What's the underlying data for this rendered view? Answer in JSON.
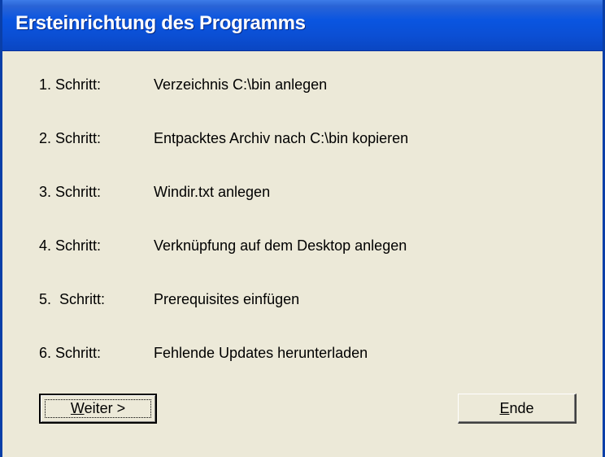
{
  "window": {
    "title": "Ersteinrichtung des Programms"
  },
  "steps": [
    {
      "number": "1. Schritt:",
      "description": "Verzeichnis C:\\bin anlegen"
    },
    {
      "number": "2. Schritt:",
      "description": "Entpacktes Archiv nach C:\\bin kopieren"
    },
    {
      "number": "3. Schritt:",
      "description": "Windir.txt anlegen"
    },
    {
      "number": "4. Schritt:",
      "description": "Verknüpfung auf dem Desktop anlegen"
    },
    {
      "number": "5.  Schritt:",
      "description": "Prerequisites einfügen"
    },
    {
      "number": "6. Schritt:",
      "description": "Fehlende Updates herunterladen"
    }
  ],
  "buttons": {
    "next": {
      "mnemonic": "W",
      "rest": "eiter >"
    },
    "end": {
      "mnemonic": "E",
      "rest": "nde"
    }
  },
  "colors": {
    "titlebar": "#0a55e0",
    "window_face": "#ece9d8",
    "title_text": "#ffffff"
  }
}
